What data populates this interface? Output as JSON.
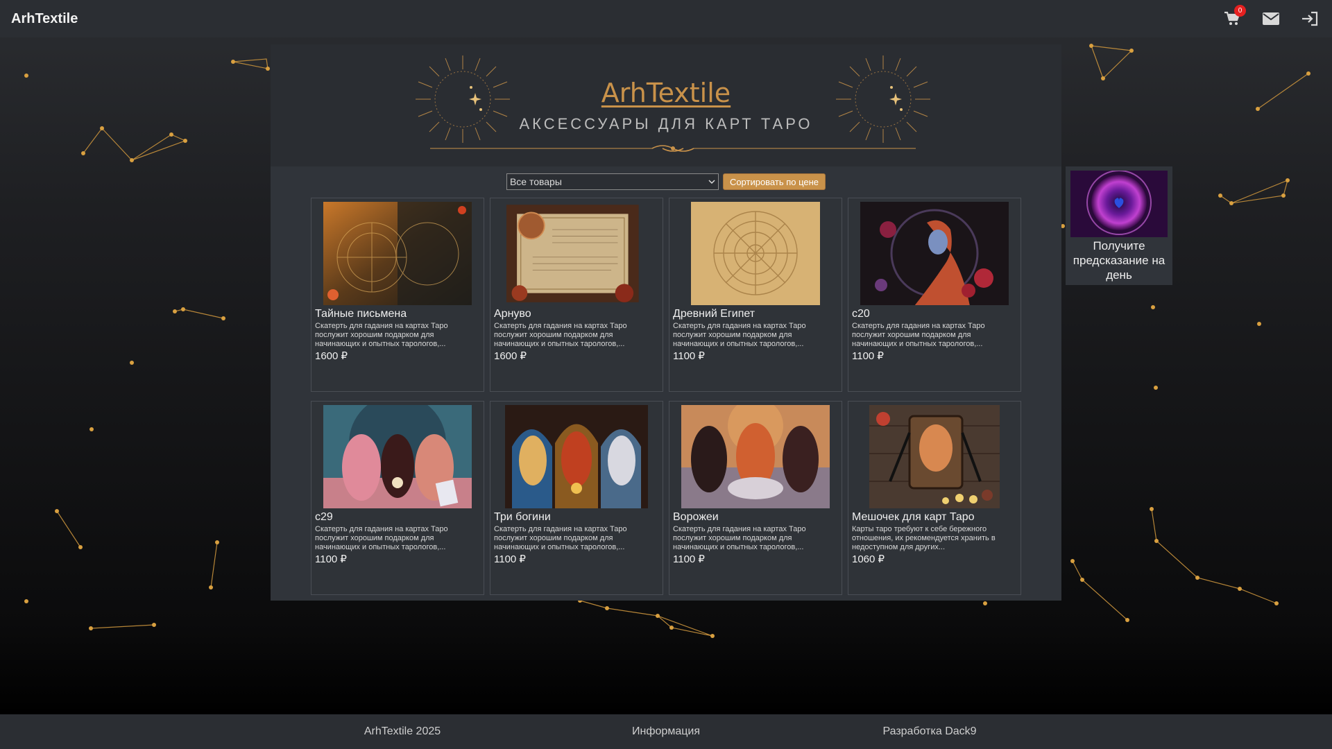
{
  "header": {
    "brand": "ArhTextile",
    "cart_count": "0"
  },
  "hero": {
    "title": "ArhTextile",
    "subtitle": "АКСЕССУАРЫ ДЛЯ КАРТ ТАРО"
  },
  "controls": {
    "filter_selected": "Все товары",
    "sort_label": "Сортировать по цене"
  },
  "products": [
    {
      "title": "Тайные письмена",
      "desc": "Скатерть для гадания на картах Таро послужит хорошим подарком для начинающих и опытных тарологов,...",
      "price": "1600 ₽"
    },
    {
      "title": "Арнуво",
      "desc": "Скатерть для гадания на картах Таро послужит хорошим подарком для начинающих и опытных тарологов,...",
      "price": "1600 ₽"
    },
    {
      "title": "Древний Египет",
      "desc": "Скатерть для гадания на картах Таро послужит хорошим подарком для начинающих и опытных тарологов,...",
      "price": "1100 ₽"
    },
    {
      "title": "c20",
      "desc": "Скатерть для гадания на картах Таро послужит хорошим подарком для начинающих и опытных тарологов,...",
      "price": "1100 ₽"
    },
    {
      "title": "c29",
      "desc": "Скатерть для гадания на картах Таро послужит хорошим подарком для начинающих и опытных тарологов,...",
      "price": "1100 ₽"
    },
    {
      "title": "Три богини",
      "desc": "Скатерть для гадания на картах Таро послужит хорошим подарком для начинающих и опытных тарологов,...",
      "price": "1100 ₽"
    },
    {
      "title": "Ворожеи",
      "desc": "Скатерть для гадания на картах Таро послужит хорошим подарком для начинающих и опытных тарологов,...",
      "price": "1100 ₽"
    },
    {
      "title": "Мешочек для карт Таро",
      "desc": "Карты таро требуют к себе бережного отношения, их рекомендуется хранить в недоступном для других...",
      "price": "1060 ₽"
    }
  ],
  "widget": {
    "text": "Получите предсказание на день"
  },
  "footer": {
    "copyright": "ArhTextile 2025",
    "info": "Информация",
    "dev": "Разработка Dack9"
  },
  "colors": {
    "accent": "#c9924a",
    "panel": "#30343a",
    "badge": "#e52020"
  }
}
